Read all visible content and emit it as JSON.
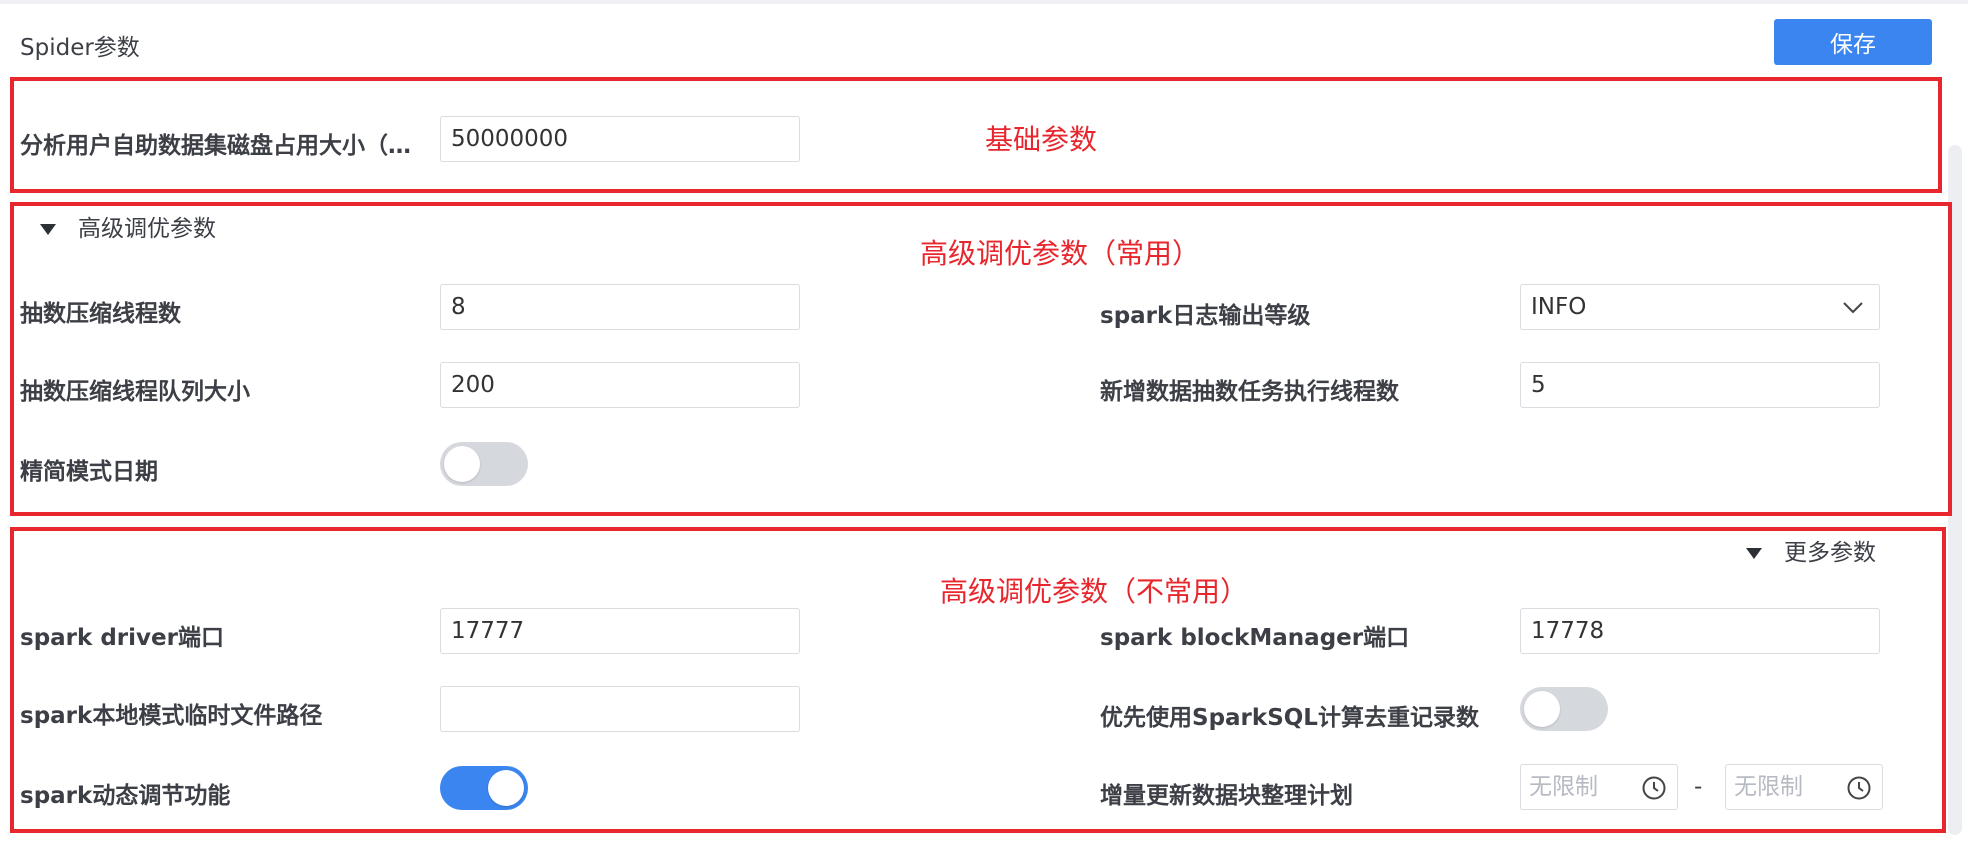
{
  "header": {
    "title": "Spider参数",
    "save_label": "保存"
  },
  "annotations": {
    "basic": "基础参数",
    "advanced_common": "高级调优参数（常用）",
    "advanced_uncommon": "高级调优参数（不常用）"
  },
  "basic": {
    "disk_label": "分析用户自助数据集磁盘占用大小（…",
    "disk_value": "50000000"
  },
  "advanced": {
    "toggle_label": "高级调优参数",
    "compress_threads_label": "抽数压缩线程数",
    "compress_threads_value": "8",
    "spark_log_level_label": "spark日志输出等级",
    "spark_log_level_value": "INFO",
    "compress_queue_label": "抽数压缩线程队列大小",
    "compress_queue_value": "200",
    "new_task_threads_label": "新增数据抽数任务执行线程数",
    "new_task_threads_value": "5",
    "simple_mode_label": "精简模式日期",
    "simple_mode_on": false
  },
  "more": {
    "toggle_label": "更多参数",
    "driver_port_label": "spark driver端口",
    "driver_port_value": "17777",
    "block_manager_label": "spark blockManager端口",
    "block_manager_value": "17778",
    "local_tmp_label": "spark本地模式临时文件路径",
    "local_tmp_value": "",
    "sparksql_dedup_label": "优先使用SparkSQL计算去重记录数",
    "sparksql_dedup_on": false,
    "dynamic_label": "spark动态调节功能",
    "dynamic_on": true,
    "incremental_label": "增量更新数据块整理计划",
    "time_start_placeholder": "无限制",
    "time_end_placeholder": "无限制",
    "time_separator": "-"
  },
  "colors": {
    "accent": "#3a85f0",
    "annotation": "#e8262d"
  }
}
